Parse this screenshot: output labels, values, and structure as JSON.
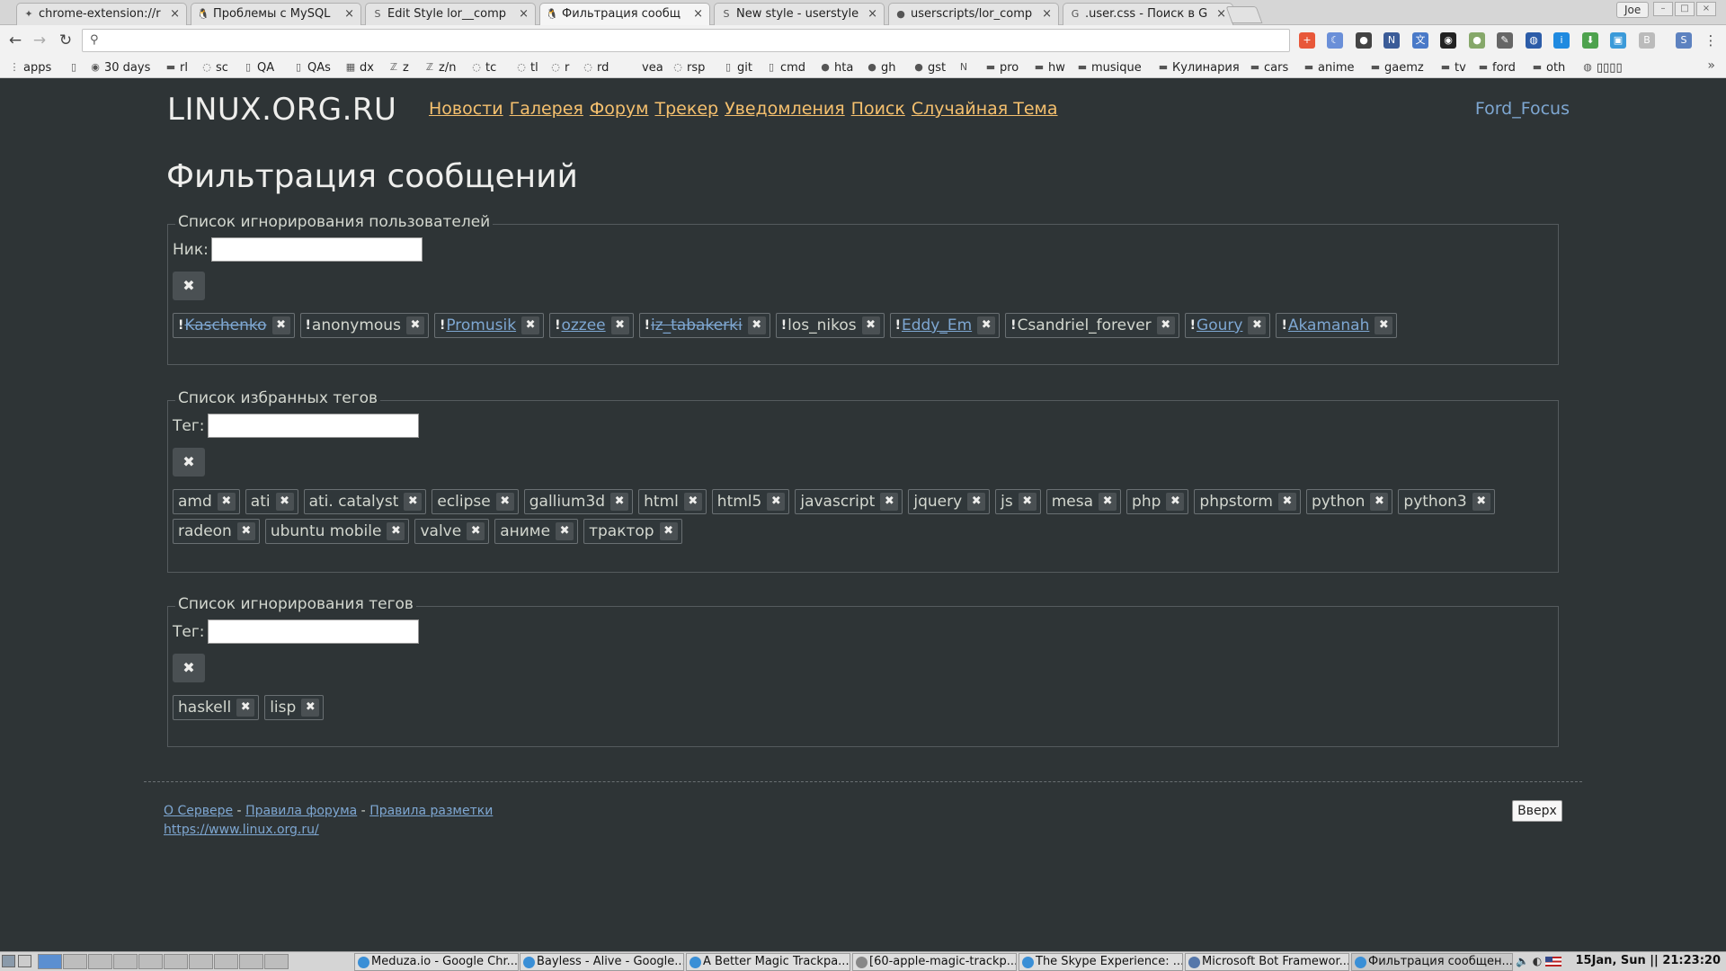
{
  "browser": {
    "tabs": [
      {
        "label": "chrome-extension://r",
        "icon": "puzzle-icon"
      },
      {
        "label": "Проблемы с MySQL",
        "icon": "tux-icon"
      },
      {
        "label": "Edit Style lor__comp",
        "icon": "stylish-icon"
      },
      {
        "label": "Фильтрация сообщ",
        "icon": "tux-icon",
        "active": true
      },
      {
        "label": "New style - userstyle",
        "icon": "stylish-icon"
      },
      {
        "label": "userscripts/lor_comp",
        "icon": "github-icon"
      },
      {
        "label": ".user.css - Поиск в G",
        "icon": "google-icon"
      }
    ],
    "tab_close": "×",
    "profile_name": "Joe",
    "address_value": "",
    "bookmarks": [
      {
        "label": "apps",
        "icon": "apps-grid-icon"
      },
      {
        "label": "",
        "icon": "page-icon"
      },
      {
        "label": "30 days",
        "icon": "circle-icon"
      },
      {
        "label": "rl",
        "icon": "folder-icon"
      },
      {
        "label": "sc",
        "icon": "swirl-icon"
      },
      {
        "label": "QA",
        "icon": "page-icon"
      },
      {
        "label": "QAs",
        "icon": "page-icon"
      },
      {
        "label": "dx",
        "icon": "windows-icon"
      },
      {
        "label": "z",
        "icon": "z-icon"
      },
      {
        "label": "z/n",
        "icon": "z-icon"
      },
      {
        "label": "tc",
        "icon": "swirl-icon"
      },
      {
        "label": "tl",
        "icon": "swirl-icon"
      },
      {
        "label": "r",
        "icon": "swirl-icon"
      },
      {
        "label": "rd",
        "icon": "swirl-icon"
      },
      {
        "label": "vea",
        "icon": ""
      },
      {
        "label": "rsp",
        "icon": "swirl-icon"
      },
      {
        "label": "git",
        "icon": "page-icon"
      },
      {
        "label": "cmd",
        "icon": "page-icon"
      },
      {
        "label": "hta",
        "icon": "github-icon"
      },
      {
        "label": "gh",
        "icon": "github-icon"
      },
      {
        "label": "gst",
        "icon": "github-icon"
      },
      {
        "label": "",
        "icon": "onenote-icon"
      },
      {
        "label": "pro",
        "icon": "folder-icon"
      },
      {
        "label": "hw",
        "icon": "folder-icon"
      },
      {
        "label": "musique",
        "icon": "folder-icon"
      },
      {
        "label": "Кулинария",
        "icon": "folder-icon"
      },
      {
        "label": "cars",
        "icon": "folder-icon"
      },
      {
        "label": "anime",
        "icon": "folder-icon"
      },
      {
        "label": "gaemz",
        "icon": "folder-icon"
      },
      {
        "label": "tv",
        "icon": "folder-icon"
      },
      {
        "label": "ford",
        "icon": "folder-icon"
      },
      {
        "label": "oth",
        "icon": "folder-icon"
      },
      {
        "label": "▯▯▯▯",
        "icon": "globe-icon"
      }
    ],
    "bookmarks_more": "»"
  },
  "site": {
    "logo": "LINUX.ORG.RU",
    "nav": [
      "Новости",
      "Галерея",
      "Форум",
      "Трекер",
      "Уведомления",
      "Поиск",
      "Случайная Тема"
    ],
    "user": "Ford_Focus",
    "page_title": "Фильтрация сообщений"
  },
  "sections": {
    "ignore_users": {
      "legend": "Список игнорирования пользователей",
      "field_label": "Ник:",
      "field_value": "",
      "add_button": "✖",
      "items": [
        {
          "text": "Kaschenko",
          "link": true,
          "strike": true,
          "excl": true
        },
        {
          "text": "anonymous",
          "link": false,
          "strike": false,
          "excl": true
        },
        {
          "text": "Promusik",
          "link": true,
          "strike": false,
          "excl": true
        },
        {
          "text": "ozzee",
          "link": true,
          "strike": false,
          "excl": true
        },
        {
          "text": "iz_tabakerki",
          "link": true,
          "strike": true,
          "excl": true
        },
        {
          "text": "los_nikos",
          "link": false,
          "strike": false,
          "excl": true
        },
        {
          "text": "Eddy_Em",
          "link": true,
          "strike": false,
          "excl": true
        },
        {
          "text": "Csandriel_forever",
          "link": false,
          "strike": false,
          "excl": true
        },
        {
          "text": "Goury",
          "link": true,
          "strike": false,
          "excl": true
        },
        {
          "text": "Akamanah",
          "link": true,
          "strike": false,
          "excl": true
        }
      ]
    },
    "favorite_tags": {
      "legend": "Список избранных тегов",
      "field_label": "Тег:",
      "field_value": "",
      "add_button": "✖",
      "items": [
        {
          "text": "amd"
        },
        {
          "text": "ati"
        },
        {
          "text": "ati. catalyst"
        },
        {
          "text": "eclipse"
        },
        {
          "text": "gallium3d"
        },
        {
          "text": "html"
        },
        {
          "text": "html5"
        },
        {
          "text": "javascript"
        },
        {
          "text": "jquery"
        },
        {
          "text": "js"
        },
        {
          "text": "mesa"
        },
        {
          "text": "php"
        },
        {
          "text": "phpstorm"
        },
        {
          "text": "python"
        },
        {
          "text": "python3"
        },
        {
          "text": "radeon"
        },
        {
          "text": "ubuntu mobile"
        },
        {
          "text": "valve"
        },
        {
          "text": "аниме"
        },
        {
          "text": "трактор"
        }
      ]
    },
    "ignore_tags": {
      "legend": "Список игнорирования тегов",
      "field_label": "Тег:",
      "field_value": "",
      "add_button": "✖",
      "items": [
        {
          "text": "haskell"
        },
        {
          "text": "lisp"
        }
      ]
    },
    "remove_glyph": "✖",
    "excl_glyph": "!"
  },
  "footer": {
    "links": [
      "О Сервере",
      "Правила форума",
      "Правила разметки"
    ],
    "separator": " - ",
    "url": "https://www.linux.org.ru/",
    "up_button": "Вверх"
  },
  "taskbar": {
    "tasks": [
      {
        "label": "Meduza.io - Google Chr...",
        "icon": "chrome-icon"
      },
      {
        "label": "Bayless - Alive - Google...",
        "icon": "chrome-icon"
      },
      {
        "label": "A Better Magic Trackpa...",
        "icon": "chrome-icon"
      },
      {
        "label": "[60-apple-magic-trackp...",
        "icon": "editor-icon"
      },
      {
        "label": "The Skype Experience: ...",
        "icon": "chrome-icon"
      },
      {
        "label": "Microsoft Bot Framewor...",
        "icon": "window-icon"
      },
      {
        "label": "Фильтрация сообщен...",
        "icon": "chrome-icon",
        "active": true
      }
    ],
    "clock": "15Jan, Sun || 21:23:20"
  },
  "colors": {
    "page_bg": "#2e3436",
    "nav_link": "#f5c06e",
    "user_link": "#7ea7d2",
    "text": "#d3d7cf"
  }
}
